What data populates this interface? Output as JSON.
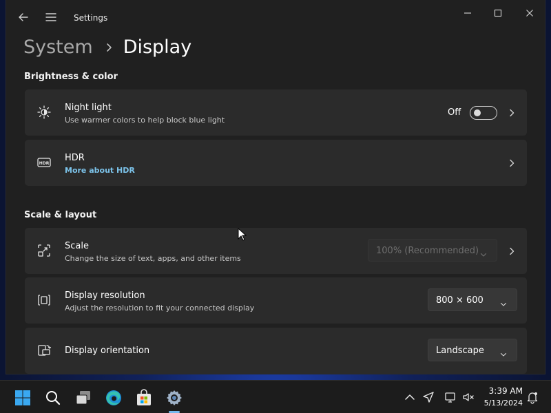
{
  "window": {
    "title": "Settings"
  },
  "breadcrumb": {
    "parent": "System",
    "current": "Display"
  },
  "sections": {
    "brightness": "Brightness & color",
    "scale": "Scale & layout"
  },
  "cards": {
    "night_light": {
      "title": "Night light",
      "subtitle": "Use warmer colors to help block blue light",
      "toggle_state": "Off",
      "toggle_on": false,
      "icon": "brightness-icon"
    },
    "hdr": {
      "title": "HDR",
      "link": "More about HDR",
      "icon": "hdr-icon"
    },
    "scale": {
      "title": "Scale",
      "subtitle": "Change the size of text, apps, and other items",
      "value": "100% (Recommended)",
      "disabled": true,
      "icon": "scale-icon"
    },
    "resolution": {
      "title": "Display resolution",
      "subtitle": "Adjust the resolution to fit your connected display",
      "value": "800 × 600",
      "icon": "resolution-icon"
    },
    "orientation": {
      "title": "Display orientation",
      "value": "Landscape",
      "icon": "orientation-icon"
    }
  },
  "taskbar": {
    "apps": [
      "start-icon",
      "search-icon",
      "task-view-icon",
      "edge-icon",
      "store-icon",
      "settings-icon"
    ],
    "active_app": "settings-icon",
    "tray": [
      "chevron-up-icon",
      "location-icon",
      "network-icon",
      "volume-muted-icon",
      "notification-icon"
    ],
    "time": "3:39 AM",
    "date": "5/13/2024"
  },
  "colors": {
    "window_bg": "#202020",
    "card_bg": "#2b2b2b",
    "accent": "#75b8ee",
    "link": "#7cc3ea"
  }
}
